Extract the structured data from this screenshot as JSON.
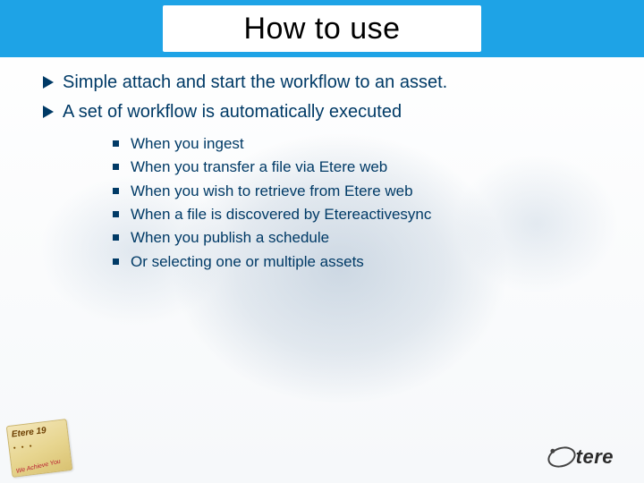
{
  "title": "How to use",
  "bullets_lvl1": [
    "Simple attach and start the workflow to an asset.",
    "A set of workflow is automatically executed"
  ],
  "bullets_lvl2": [
    "When you ingest",
    "When you transfer a file via Etere web",
    "When you wish to retrieve from Etere web",
    "When a file is discovered by Etereactivesync",
    "When you publish a schedule",
    "Or selecting one or multiple assets"
  ],
  "logo_right_text": "tere",
  "logo_left_line1": "Etere 19",
  "logo_left_line2": "We Achieve You"
}
